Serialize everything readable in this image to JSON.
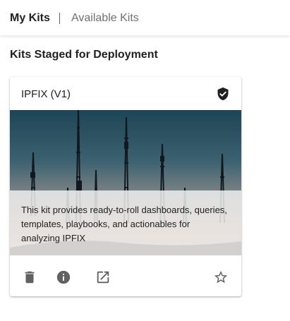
{
  "tabs": {
    "my_kits": "My Kits",
    "available_kits": "Available Kits"
  },
  "section": {
    "title": "Kits Staged for Deployment"
  },
  "kit_card": {
    "title": "IPFIX (V1)",
    "description": "This kit provides ready-to-roll dashboards, queries, templates, playbooks, and actionables for analyzing IPFIX",
    "icons": {
      "status": "verified-shield-icon",
      "actions": [
        "delete-icon",
        "info-icon",
        "open-in-new-icon"
      ],
      "favorite": "star-outline-icon"
    }
  },
  "colors": {
    "active_tab": "#212121",
    "inactive_tab": "#6f6f6f",
    "icon": "#616161",
    "sky_top": "#1f4a5f",
    "sky_bottom": "#c9a188"
  }
}
